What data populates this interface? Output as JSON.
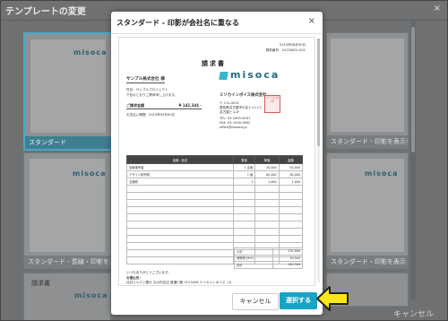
{
  "background": {
    "title": "テンプレートの変更",
    "close_symbol": "×",
    "cancel_label": "キャンセル",
    "tiles": [
      {
        "caption": "スタンダード",
        "logo": "misoca",
        "selected": true
      },
      {
        "caption": "スタンダード - 印影を表示しない",
        "logo": "misoca",
        "selected": false
      },
      {
        "caption": "スタンダード - 罫線・印影を表示しない",
        "logo": "misoca",
        "selected": false
      },
      {
        "caption": "スタンダード・印影を表示",
        "logo": "misoca",
        "selected": false
      },
      {
        "caption": "請求書",
        "logo": "misoca",
        "selected": false
      }
    ]
  },
  "modal": {
    "title": "スタンダード - 印影が会社名に重なる",
    "close_symbol": "×",
    "cancel_label": "キャンセル",
    "select_label": "選択する"
  },
  "invoice": {
    "date": "2013年08月30日",
    "number": "請求番号：20130002-001",
    "title": "請求書",
    "customer": "サンプル株式会社 様",
    "subject": "件名：サンプルプロジェクト",
    "greeting": "下記のとおりご請求申し上げます。",
    "amount_label": "ご請求金額",
    "amount_value": "¥ 142,344 -",
    "due": "お支払い期限：2013年09月30日",
    "logo": "misoca",
    "company": "ミソカインボイス株式会社",
    "address": [
      "〒 111-0001",
      "愛知県名古屋市中区1-11-11",
      "名古屋ビル1F"
    ],
    "tel": "TEL: 03-1000-0001",
    "fax": "FAX: 03-1000-0002",
    "email": "office@misoca.jp",
    "stamp": "ミソカ 社印",
    "columns": [
      "品番・品名",
      "数量",
      "単価",
      "金額"
    ],
    "rows": [
      [
        "品番番号者",
        "1 企画",
        "50,000",
        "50,000"
      ],
      [
        "デザイン制作費",
        "1 画",
        "80,000",
        "80,000"
      ],
      [
        "交通費",
        "1",
        "1,800",
        "1,800"
      ],
      [
        "",
        "",
        "",
        ""
      ],
      [
        "",
        "",
        "",
        ""
      ],
      [
        "",
        "",
        "",
        ""
      ],
      [
        "",
        "",
        "",
        ""
      ],
      [
        "",
        "",
        "",
        ""
      ],
      [
        "",
        "",
        "",
        ""
      ],
      [
        "",
        "",
        "",
        ""
      ],
      [
        "",
        "",
        "",
        ""
      ],
      [
        "",
        "",
        "",
        ""
      ],
      [
        "",
        "",
        "",
        ""
      ],
      [
        "",
        "",
        "",
        ""
      ]
    ],
    "totals": [
      [
        "小計",
        "131,800"
      ],
      [
        "消費税 (8%)",
        "10,544"
      ],
      [
        "合計",
        "142,344"
      ]
    ],
    "note": "いつもありがとうございます。",
    "bank_label": "お振込先：",
    "bank": "住井ジャパン銀行 丸の内支店 普通口座 0123456 ミソカインボイス（カ"
  }
}
